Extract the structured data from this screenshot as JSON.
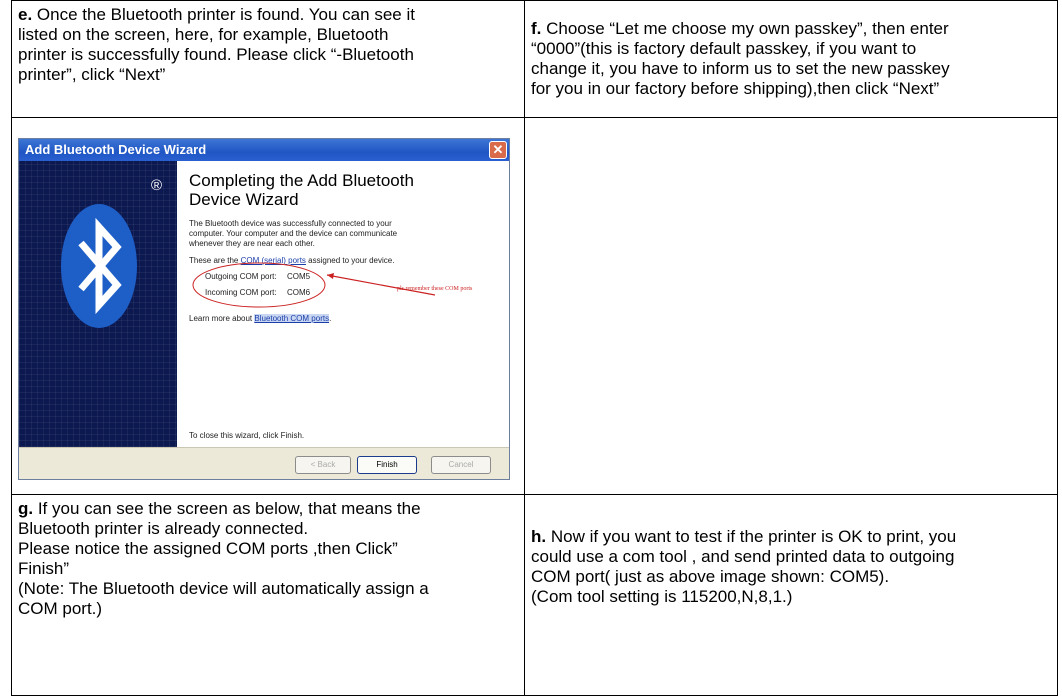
{
  "cells": {
    "e": {
      "letter": "e.",
      "lines": [
        " Once the Bluetooth printer is found. You can see it",
        "listed on the screen, here, for example, Bluetooth",
        "printer is successfully found. Please click “-Bluetooth",
        "printer”, click “Next”"
      ]
    },
    "f": {
      "letter": "f.",
      "lines": [
        " Choose “Let me choose my own passkey”, then enter",
        "“0000”(this is factory default passkey, if you want to",
        "change it, you have to inform us to set the new passkey",
        "for you in our factory before shipping),then click “Next”"
      ]
    },
    "g": {
      "letter": "g.",
      "lines": [
        " If you can see the screen as below, that means the",
        "Bluetooth printer is already connected.",
        "Please notice the assigned COM ports ,then Click”",
        "Finish”",
        "(Note: The Bluetooth device will automatically assign a",
        "COM port.)"
      ]
    },
    "h": {
      "letter": "h.",
      "lines": [
        " Now if you want to test if the printer is OK to print, you",
        "could use a com tool , and send printed data to outgoing",
        "COM port( just as above image shown: COM5).",
        "(Com tool setting is 115200,N,8,1.)"
      ]
    }
  },
  "wizard": {
    "window_title": "Add Bluetooth Device Wizard",
    "close_glyph": "✕",
    "heading_line1": "Completing the Add Bluetooth",
    "heading_line2": "Device Wizard",
    "intro_lines": [
      "The Bluetooth device was successfully connected to your",
      "computer. Your computer and the device can communicate",
      "whenever they are near each other."
    ],
    "ports_prefix": "These are the ",
    "ports_link": "COM (serial) ports",
    "ports_suffix": " assigned to your device.",
    "outgoing_label": "Outgoing COM port:",
    "outgoing_value": "COM5",
    "incoming_label": "Incoming COM port:",
    "incoming_value": "COM6",
    "annotation": "pls remember these COM ports",
    "learn_prefix": "Learn more about ",
    "learn_link": "Bluetooth COM ports",
    "learn_suffix": ".",
    "close_hint": "To close this wizard, click Finish.",
    "registered_mark": "®",
    "buttons": {
      "back": "< Back",
      "finish": "Finish",
      "cancel": "Cancel"
    }
  },
  "colors": {
    "title_bar": "#1f56c4",
    "side_panel": "#0c1850",
    "bluetooth_blue": "#1d5fc7",
    "annotation_red": "#cc2222"
  }
}
